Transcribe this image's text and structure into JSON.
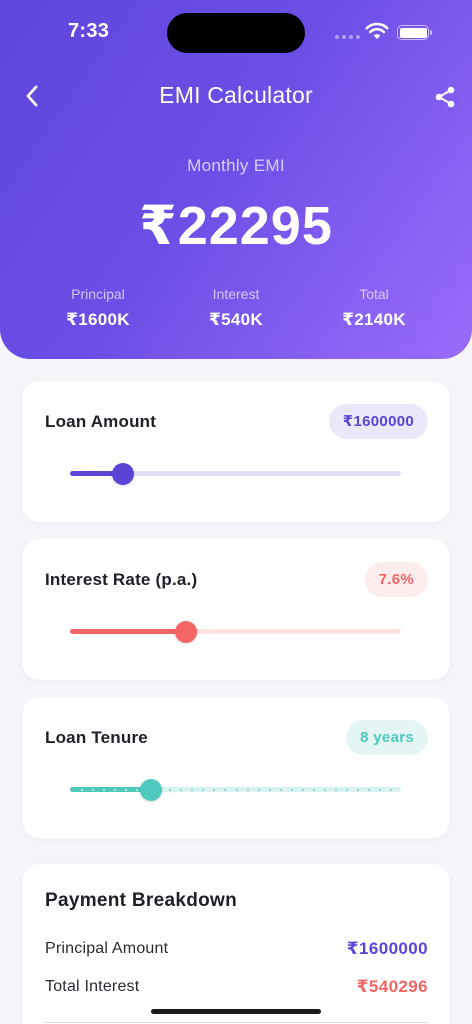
{
  "status": {
    "time": "7:33"
  },
  "nav": {
    "title": "EMI Calculator"
  },
  "emi": {
    "label": "Monthly EMI",
    "value": "₹22295"
  },
  "summary": [
    {
      "label": "Principal",
      "value": "₹1600K"
    },
    {
      "label": "Interest",
      "value": "₹540K"
    },
    {
      "label": "Total",
      "value": "₹2140K"
    }
  ],
  "sliders": {
    "loan_amount": {
      "label": "Loan Amount",
      "value": "₹1600000",
      "fraction": 0.16,
      "color": "#5b43d6",
      "track": "#e4def8",
      "pill_bg": "#ece8fb"
    },
    "interest_rate": {
      "label": "Interest Rate (p.a.)",
      "value": "7.6%",
      "fraction": 0.35,
      "color": "#f56565",
      "track": "#fde1e1",
      "pill_bg": "#fdecec"
    },
    "loan_tenure": {
      "label": "Loan Tenure",
      "value": "8 years",
      "fraction": 0.245,
      "color": "#4fc9bd",
      "track": "#d6f3f0",
      "pill_bg": "#e3f6f4"
    }
  },
  "breakdown": {
    "title": "Payment Breakdown",
    "rows": [
      {
        "label": "Principal Amount",
        "value": "₹1600000",
        "color": "#5b43d6"
      },
      {
        "label": "Total Interest",
        "value": "₹540296",
        "color": "#f56565"
      }
    ]
  }
}
